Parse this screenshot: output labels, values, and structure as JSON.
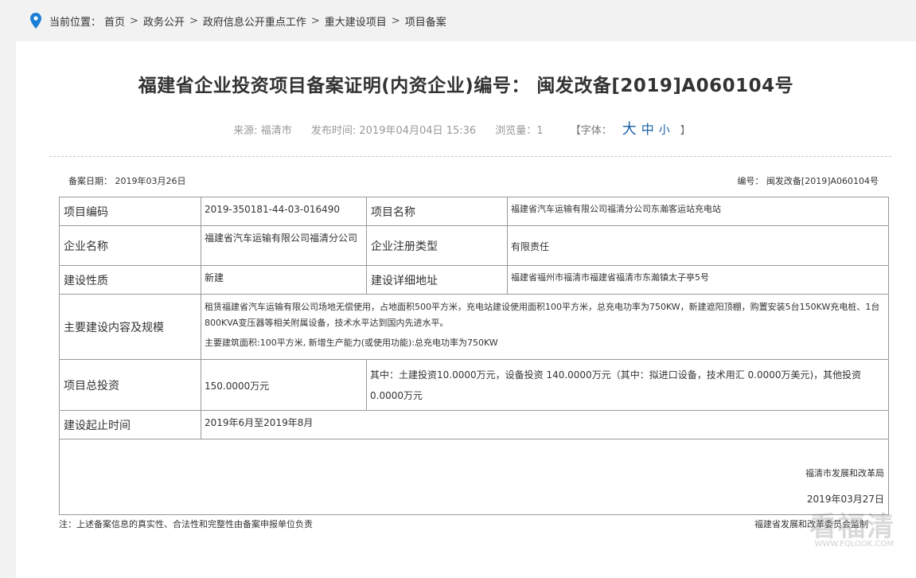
{
  "breadcrumb": {
    "prefix": "当前位置：",
    "items": [
      "首页",
      "政务公开",
      "政府信息公开重点工作",
      "重大建设项目",
      "项目备案"
    ],
    "separator": ">"
  },
  "article": {
    "title": "福建省企业投资项目备案证明(内资企业)编号： 闽发改备[2019]A060104号",
    "source": "来源: 福清市",
    "publish_time": "发布时间: 2019年04月04日 15:36",
    "views": "浏览量：1",
    "font_label": "【字体：",
    "font_big": "大",
    "font_mid": "中",
    "font_small": "小",
    "font_close": "】"
  },
  "record": {
    "date_label": "备案日期：",
    "date": "2019年03月26日",
    "no_label": "编号：",
    "no": "闽发改备[2019]A060104号",
    "rows": {
      "code_label": "项目编码",
      "code": "2019-350181-44-03-016490",
      "name_label": "项目名称",
      "name": "福建省汽车运输有限公司福清分公司东瀚客运站充电站",
      "company_label": "企业名称",
      "company": "福建省汽车运输有限公司福清分公司",
      "type_label": "企业注册类型",
      "type": "有限责任",
      "nature_label": "建设性质",
      "nature": "新建",
      "address_label": "建设详细地址",
      "address": "福建省福州市福清市福建省福清市东瀚镇太子亭5号",
      "content_label": "主要建设内容及规模",
      "content_1": "租赁福建省汽车运输有限公司场地无偿使用，占地面积500平方米，充电站建设使用面积100平方米，总充电功率为750KW，新建遮阳顶棚，购置安装5台150KW充电桩、1台800KVA变压器等相关附属设备，技术水平达到国内先进水平。",
      "content_2": "主要建筑面积:100平方米, 新增生产能力(或使用功能):总充电功率为750KW",
      "investment_label": "项目总投资",
      "investment": "150.0000万元",
      "investment_detail": "其中：土建投资10.0000万元，设备投资 140.0000万元（其中：拟进口设备，技术用汇 0.0000万美元)，其他投资0.0000万元",
      "period_label": "建设起止时间",
      "period": "2019年6月至2019年8月"
    },
    "agency": "福清市发展和改革局",
    "sign_date": "2019年03月27日",
    "note": "注：上述备案信息的真实性、合法性和完整性由备案申报单位负责",
    "footer_right": "福建省发展和改革委员会监制"
  },
  "watermark": {
    "big": "看福清",
    "small": "WWW.FQLOOK.COM"
  },
  "colors": {
    "link": "#1a5fa8",
    "pin": "#1a7fd4"
  }
}
